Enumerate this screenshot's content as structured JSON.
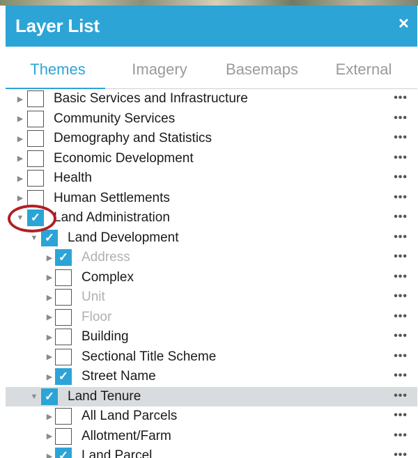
{
  "panel": {
    "title": "Layer List",
    "close_glyph": "×"
  },
  "tabs": [
    {
      "label": "Themes",
      "active": true
    },
    {
      "label": "Imagery",
      "active": false
    },
    {
      "label": "Basemaps",
      "active": false
    },
    {
      "label": "External",
      "active": false
    }
  ],
  "more_glyph": "•••",
  "check_glyph": "✓",
  "accent_color": "#2ca4d6",
  "annotation_color": "#b21f24",
  "layers": [
    {
      "label": "Basic Services and Infrastructure",
      "level": 0,
      "checked": false,
      "expanded": false,
      "muted": false
    },
    {
      "label": "Community Services",
      "level": 0,
      "checked": false,
      "expanded": false,
      "muted": false
    },
    {
      "label": "Demography and Statistics",
      "level": 0,
      "checked": false,
      "expanded": false,
      "muted": false
    },
    {
      "label": "Economic Development",
      "level": 0,
      "checked": false,
      "expanded": false,
      "muted": false
    },
    {
      "label": "Health",
      "level": 0,
      "checked": false,
      "expanded": false,
      "muted": false
    },
    {
      "label": "Human Settlements",
      "level": 0,
      "checked": false,
      "expanded": false,
      "muted": false
    },
    {
      "label": "Land Administration",
      "level": 0,
      "checked": true,
      "expanded": true,
      "muted": false
    },
    {
      "label": "Land Development",
      "level": 1,
      "checked": true,
      "expanded": true,
      "muted": false
    },
    {
      "label": "Address",
      "level": 2,
      "checked": true,
      "expanded": false,
      "muted": true
    },
    {
      "label": "Complex",
      "level": 2,
      "checked": false,
      "expanded": false,
      "muted": false
    },
    {
      "label": "Unit",
      "level": 2,
      "checked": false,
      "expanded": false,
      "muted": true
    },
    {
      "label": "Floor",
      "level": 2,
      "checked": false,
      "expanded": false,
      "muted": true
    },
    {
      "label": "Building",
      "level": 2,
      "checked": false,
      "expanded": false,
      "muted": false
    },
    {
      "label": "Sectional Title Scheme",
      "level": 2,
      "checked": false,
      "expanded": false,
      "muted": false
    },
    {
      "label": "Street Name",
      "level": 2,
      "checked": true,
      "expanded": false,
      "muted": false
    },
    {
      "label": "Land Tenure",
      "level": 1,
      "checked": true,
      "expanded": true,
      "muted": false,
      "selected": true
    },
    {
      "label": "All Land Parcels",
      "level": 2,
      "checked": false,
      "expanded": false,
      "muted": false
    },
    {
      "label": "Allotment/Farm",
      "level": 2,
      "checked": false,
      "expanded": false,
      "muted": false
    },
    {
      "label": "Land Parcel",
      "level": 2,
      "checked": true,
      "expanded": false,
      "muted": false
    }
  ]
}
